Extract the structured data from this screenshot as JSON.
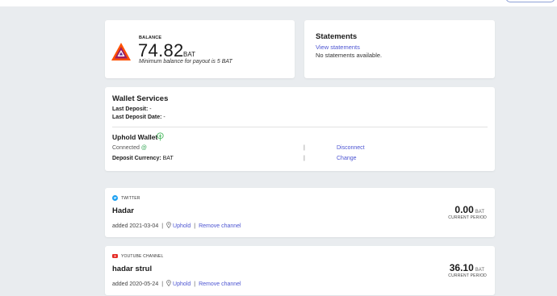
{
  "balance": {
    "label": "BALANCE",
    "amount": "74.82",
    "unit": "BAT",
    "note": "Minimum balance for payout is 5 BAT"
  },
  "statements": {
    "title": "Statements",
    "link": "View statements",
    "empty": "No statements available."
  },
  "wallet": {
    "title": "Wallet Services",
    "last_deposit_label": "Last Deposit:",
    "last_deposit_value": " -",
    "last_deposit_date_label": "Last Deposit Date:",
    "last_deposit_date_value": " -",
    "uphold_title": "Uphold Wallet",
    "connected_label": "Connected",
    "connected_at": "@",
    "deposit_currency_label": "Deposit Currency:",
    "deposit_currency_value": " BAT",
    "pipe": "|",
    "disconnect": "Disconnect",
    "change": "Change"
  },
  "channels": [
    {
      "type": "TWITTER",
      "icon": "twitter-icon",
      "name": "Hadar",
      "added": "added 2021-03-04",
      "provider": "Uphold",
      "remove": "Remove channel",
      "amount": "0.00",
      "unit": "BAT",
      "period": "CURRENT PERIOD"
    },
    {
      "type": "YOUTUBE CHANNEL",
      "icon": "youtube-icon",
      "name": "hadar strul",
      "added": "added 2020-05-24",
      "provider": "Uphold",
      "remove": "Remove channel",
      "amount": "36.10",
      "unit": "BAT",
      "period": "CURRENT PERIOD"
    }
  ],
  "colors": {
    "accent": "#4c54d2",
    "bat_orange": "#ff5000",
    "bat_purple": "#662d91",
    "background": "#e9ecef"
  }
}
